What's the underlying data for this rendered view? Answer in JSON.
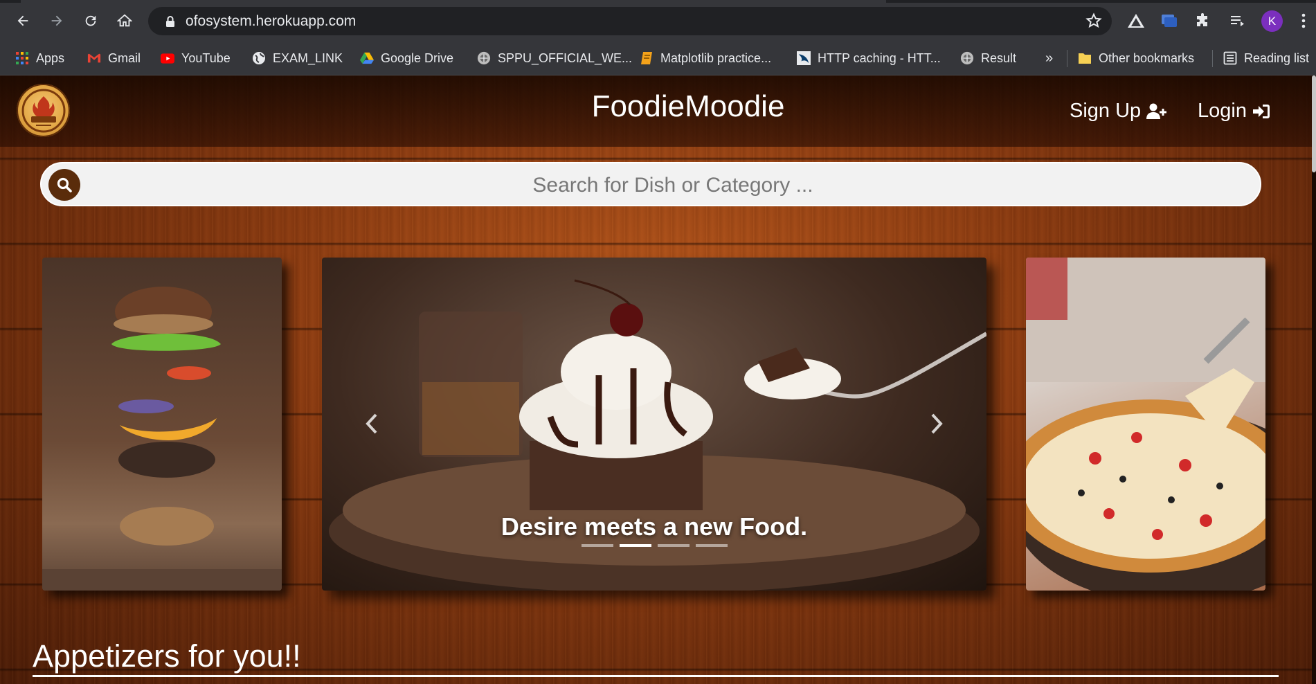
{
  "browser": {
    "url": "ofosystem.herokuapp.com",
    "avatar_letter": "K",
    "bookmarks": [
      {
        "label": "Apps",
        "icon": "apps-grid-icon"
      },
      {
        "label": "Gmail",
        "icon": "gmail-icon"
      },
      {
        "label": "YouTube",
        "icon": "youtube-icon"
      },
      {
        "label": "EXAM_LINK",
        "icon": "globe-icon"
      },
      {
        "label": "Google Drive",
        "icon": "google-drive-icon"
      },
      {
        "label": "SPPU_OFFICIAL_WE...",
        "icon": "sppu-icon"
      },
      {
        "label": "Matplotlib practice...",
        "icon": "notebook-icon"
      },
      {
        "label": "HTTP caching - HTT...",
        "icon": "mdn-icon"
      },
      {
        "label": "Result",
        "icon": "sppu-icon"
      }
    ],
    "overflow_label": "»",
    "other_bookmarks": "Other bookmarks",
    "reading_list": "Reading list"
  },
  "site": {
    "brand": "FoodieMoodie",
    "nav": {
      "signup": "Sign Up",
      "login": "Login"
    },
    "search": {
      "placeholder": "Search for Dish or Category ..."
    },
    "carousel": {
      "caption": "Desire meets a new Food.",
      "indicator_count": 4,
      "active_index": 1
    },
    "section_title": "Appetizers for you!!"
  },
  "colors": {
    "accent_brown": "#5a2c0b",
    "browser_frame": "#35363a",
    "avatar": "#7b2fbe"
  }
}
